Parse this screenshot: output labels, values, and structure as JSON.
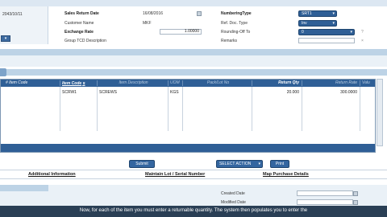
{
  "header_left": {
    "date": "2043/10/11",
    "mini_select": "▾"
  },
  "form": {
    "sales_return_date_label": "Sales Return Date",
    "sales_return_date_value": "16/08/2016",
    "customer_name_label": "Customer Name",
    "customer_name_value": "MKF",
    "exchange_rate_label": "Exchange Rate",
    "exchange_rate_value": "1.00000",
    "group_tcd_label": "Group TCD Description",
    "numbering_type_label": "NumberingType",
    "numbering_type_value": "SRT1",
    "ref_doc_type_label": "Ref. Doc. Type",
    "ref_doc_type_value": "Inv",
    "rounding_off_label": "Rounding-Off To",
    "rounding_off_value": "0",
    "remarks_label": "Remarks"
  },
  "grid": {
    "columns": [
      "# Item Code",
      "Item Code",
      "Item Description",
      "UOM",
      "Pack/Lot No",
      "Return Qty",
      "Return Rate",
      "Valu"
    ],
    "rows": [
      {
        "item_code": "SCRW1",
        "item_desc": "SCREWS",
        "uom": "KGS",
        "lot": "",
        "qty": "20.000",
        "rate": "300.0000"
      }
    ]
  },
  "buttons": {
    "submit": "Submit",
    "select_action": "SELECT ACTION",
    "print": "Print"
  },
  "links": {
    "additional_info": "Additional Information",
    "maintain_lot": "Maintain Lot / Serial Number",
    "map_purchase": "Map Purchase Details"
  },
  "bottom": {
    "created_date_label": "Created Date",
    "modified_date_label": "Modified Date"
  },
  "subtitle": "Now, for each of the item you must enter a returnable quantity. The system then populates you to enter the"
}
